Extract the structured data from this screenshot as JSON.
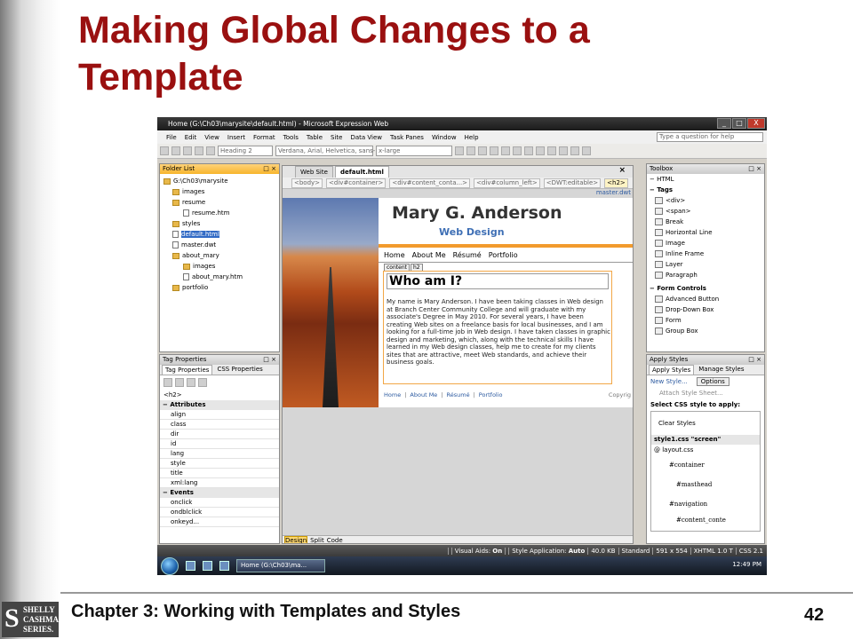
{
  "slide": {
    "title": "Making Global Changes to a Template",
    "footer": "Chapter 3: Working with Templates and Styles",
    "page_number": "42",
    "logo": {
      "letter": "S",
      "line1": "SHELLY",
      "line2": "CASHMAN",
      "line3": "SERIES."
    }
  },
  "app": {
    "window_title": "Home (G:\\Ch03\\marysite\\default.html) - Microsoft Expression Web",
    "window_controls": {
      "minimize": "_",
      "maximize": "□",
      "close": "X"
    },
    "menu": [
      "File",
      "Edit",
      "View",
      "Insert",
      "Format",
      "Tools",
      "Table",
      "Site",
      "Data View",
      "Task Panes",
      "Window",
      "Help"
    ],
    "help_placeholder": "Type a question for help",
    "toolbar": {
      "style_combo": "Heading 2",
      "font_combo": "Verdana, Arial, Helvetica, sans-",
      "size_combo": "x-large"
    },
    "folder_list": {
      "title": "Folder List",
      "items": [
        {
          "label": "G:\\Ch03\\marysite",
          "type": "folder",
          "depth": 0
        },
        {
          "label": "images",
          "type": "folder",
          "depth": 1
        },
        {
          "label": "resume",
          "type": "folder",
          "depth": 1
        },
        {
          "label": "resume.htm",
          "type": "file",
          "depth": 2
        },
        {
          "label": "styles",
          "type": "folder",
          "depth": 1
        },
        {
          "label": "default.html",
          "type": "file",
          "depth": 1,
          "selected": true
        },
        {
          "label": "master.dwt",
          "type": "file",
          "depth": 1
        },
        {
          "label": "about_mary",
          "type": "folder",
          "depth": 1
        },
        {
          "label": "images",
          "type": "folder",
          "depth": 2
        },
        {
          "label": "about_mary.htm",
          "type": "file",
          "depth": 2
        },
        {
          "label": "portfolio",
          "type": "folder",
          "depth": 1
        }
      ]
    },
    "tag_properties": {
      "title": "Tag Properties",
      "tabs": [
        "Tag Properties",
        "CSS Properties"
      ],
      "tag": "<h2>",
      "attributes_label": "Attributes",
      "attributes": [
        "align",
        "class",
        "dir",
        "id",
        "lang",
        "style",
        "title",
        "xml:lang"
      ],
      "events_label": "Events",
      "events": [
        "onclick",
        "ondblclick",
        "onkeyd..."
      ]
    },
    "document": {
      "tabs": [
        "Web Site",
        "default.html"
      ],
      "close": "×",
      "breadcrumbs": [
        "<body>",
        "<div#container>",
        "<div#content_conta...>",
        "<div#column_left>",
        "<DWT:editable>",
        "<h2>"
      ],
      "template_label": "master.dwt",
      "site": {
        "name": "Mary G. Anderson",
        "subtitle": "Web Design",
        "nav": [
          "Home",
          "About Me",
          "Résumé",
          "Portfolio"
        ],
        "content_tag": "content",
        "h2_tag": "h2",
        "heading": "Who am I?",
        "paragraph": "My name is Mary Anderson. I have been taking classes in Web design at Branch Center Community College and will graduate with my associate's Degree in May 2010. For several years, I have been creating Web sites on a freelance basis for local businesses, and I am looking for a full-time job in Web design. I have taken classes in graphic design and marketing, which, along with the technical skills I have learned in my Web design classes, help me to create for my clients sites that are attractive, meet Web standards, and achieve their business goals.",
        "footer_links": [
          "Home",
          "About Me",
          "Résumé",
          "Portfolio"
        ],
        "separator": "|",
        "copyright": "Copyrig"
      },
      "view_tabs": [
        "Design",
        "Split",
        "Code"
      ]
    },
    "toolbox": {
      "title": "Toolbox",
      "html_label": "HTML",
      "tags_label": "Tags",
      "tags": [
        "<div>",
        "<span>",
        "Break",
        "Horizontal Line",
        "Image",
        "Inline Frame",
        "Layer",
        "Paragraph"
      ],
      "form_label": "Form Controls",
      "form": [
        "Advanced Button",
        "Drop-Down Box",
        "Form",
        "Group Box"
      ]
    },
    "apply_styles": {
      "title": "Apply Styles",
      "tabs": [
        "Apply Styles",
        "Manage Styles"
      ],
      "new_style": "New Style...",
      "options": "Options",
      "attach": "Attach Style Sheet...",
      "select_label": "Select CSS style to apply:",
      "clear": "Clear Styles",
      "group": "style1.css \"screen\"",
      "file": "@ layout.css",
      "styles": [
        "#container",
        "#masthead",
        "#navigation",
        "#content_conte"
      ]
    },
    "status": {
      "visual_aids_label": "Visual Aids:",
      "visual_aids": "On",
      "style_app_label": "Style Application:",
      "style_app": "Auto",
      "size": "40.0 KB",
      "mode": "Standard",
      "dims": "591 x 554",
      "doctype": "XHTML 1.0 T",
      "css": "CSS 2.1"
    },
    "taskbar": {
      "task": "Home (G:\\Ch03\\ma...",
      "time": "12:49 PM"
    }
  }
}
